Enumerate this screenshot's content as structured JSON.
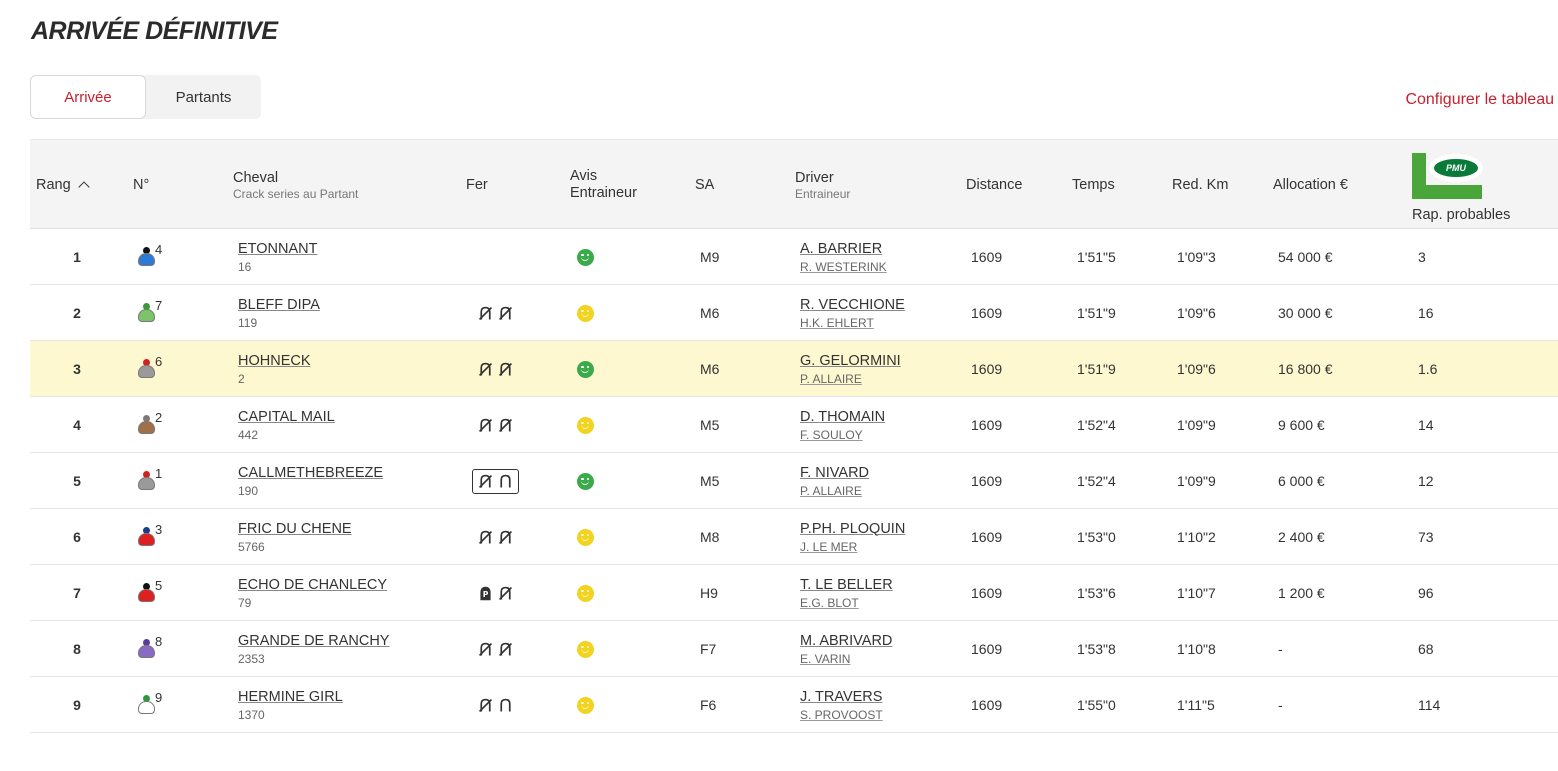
{
  "page_title": "ARRIVÉE DÉFINITIVE",
  "tabs": [
    {
      "label": "Arrivée",
      "active": true
    },
    {
      "label": "Partants",
      "active": false
    }
  ],
  "config_link": "Configurer le tableau",
  "headers": {
    "rang": "Rang",
    "num": "N°",
    "cheval": "Cheval",
    "cheval_sub": "Crack series au Partant",
    "fer": "Fer",
    "avis_1": "Avis",
    "avis_2": "Entraineur",
    "sa": "SA",
    "driver": "Driver",
    "driver_sub": "Entraineur",
    "distance": "Distance",
    "temps": "Temps",
    "red": "Red. Km",
    "alloc": "Allocation €",
    "rap": "Rap. probables",
    "pmu_logo_text": "PMU"
  },
  "colors": {
    "accent": "#c8202f",
    "highlight_row": "#fdf8cf",
    "smiley_green": "#3aaa4a",
    "smiley_yellow": "#f2d321",
    "pmu_green": "#4aa63a"
  },
  "rows": [
    {
      "rang": "1",
      "num": "4",
      "silk_head": "#111111",
      "silk_body": "#2e7bd6",
      "cheval": "ETONNANT",
      "crack": "16",
      "fer": "none",
      "avis": "green",
      "sa": "M9",
      "driver": "A. BARRIER",
      "trainer": "R. WESTERINK",
      "distance": "1609",
      "temps": "1'51\"5",
      "red": "1'09\"3",
      "alloc": "54 000 €",
      "rap": "3",
      "highlight": false
    },
    {
      "rang": "2",
      "num": "7",
      "silk_head": "#3a9a3a",
      "silk_body": "#7cc46a",
      "cheval": "BLEFF DIPA",
      "crack": "119",
      "fer": "D4",
      "avis": "yellow",
      "sa": "M6",
      "driver": "R. VECCHIONE",
      "trainer": "H.K. EHLERT",
      "distance": "1609",
      "temps": "1'51\"9",
      "red": "1'09\"6",
      "alloc": "30 000 €",
      "rap": "16",
      "highlight": false
    },
    {
      "rang": "3",
      "num": "6",
      "silk_head": "#d42020",
      "silk_body": "#9a9a9a",
      "cheval": "HOHNECK",
      "crack": "2",
      "fer": "D4",
      "avis": "green",
      "sa": "M6",
      "driver": "G. GELORMINI",
      "trainer": "P. ALLAIRE",
      "distance": "1609",
      "temps": "1'51\"9",
      "red": "1'09\"6",
      "alloc": "16 800 €",
      "rap": "1.6",
      "highlight": true
    },
    {
      "rang": "4",
      "num": "2",
      "silk_head": "#7a7a7a",
      "silk_body": "#a0704a",
      "cheval": "CAPITAL MAIL",
      "crack": "442",
      "fer": "D4",
      "avis": "yellow",
      "sa": "M5",
      "driver": "D. THOMAIN",
      "trainer": "F. SOULOY",
      "distance": "1609",
      "temps": "1'52\"4",
      "red": "1'09\"9",
      "alloc": "9 600 €",
      "rap": "14",
      "highlight": false
    },
    {
      "rang": "5",
      "num": "1",
      "silk_head": "#d42020",
      "silk_body": "#9a9a9a",
      "cheval": "CALLMETHEBREEZE",
      "crack": "190",
      "fer": "DA-boxed",
      "avis": "green",
      "sa": "M5",
      "driver": "F. NIVARD",
      "trainer": "P. ALLAIRE",
      "distance": "1609",
      "temps": "1'52\"4",
      "red": "1'09\"9",
      "alloc": "6 000 €",
      "rap": "12",
      "highlight": false
    },
    {
      "rang": "6",
      "num": "3",
      "silk_head": "#1e3a8a",
      "silk_body": "#e02020",
      "cheval": "FRIC DU CHENE",
      "crack": "5766",
      "fer": "D4",
      "avis": "yellow",
      "sa": "M8",
      "driver": "P.PH. PLOQUIN",
      "trainer": "J. LE MER",
      "distance": "1609",
      "temps": "1'53\"0",
      "red": "1'10\"2",
      "alloc": "2 400 €",
      "rap": "73",
      "highlight": false
    },
    {
      "rang": "7",
      "num": "5",
      "silk_head": "#111111",
      "silk_body": "#e02020",
      "cheval": "ECHO DE CHANLECY",
      "crack": "79",
      "fer": "PP",
      "avis": "yellow",
      "sa": "H9",
      "driver": "T. LE BELLER",
      "trainer": "E.G. BLOT",
      "distance": "1609",
      "temps": "1'53\"6",
      "red": "1'10\"7",
      "alloc": "1 200 €",
      "rap": "96",
      "highlight": false
    },
    {
      "rang": "8",
      "num": "8",
      "silk_head": "#5a3a9a",
      "silk_body": "#8a6ac4",
      "cheval": "GRANDE DE RANCHY",
      "crack": "2353",
      "fer": "D4",
      "avis": "yellow",
      "sa": "F7",
      "driver": "M. ABRIVARD",
      "trainer": "E. VARIN",
      "distance": "1609",
      "temps": "1'53\"8",
      "red": "1'10\"8",
      "alloc": "-",
      "rap": "68",
      "highlight": false
    },
    {
      "rang": "9",
      "num": "9",
      "silk_head": "#2a9a3a",
      "silk_body": "#ffffff",
      "cheval": "HERMINE GIRL",
      "crack": "1370",
      "fer": "DA",
      "avis": "yellow",
      "sa": "F6",
      "driver": "J. TRAVERS",
      "trainer": "S. PROVOOST",
      "distance": "1609",
      "temps": "1'55\"0",
      "red": "1'11\"5",
      "alloc": "-",
      "rap": "114",
      "highlight": false
    }
  ]
}
